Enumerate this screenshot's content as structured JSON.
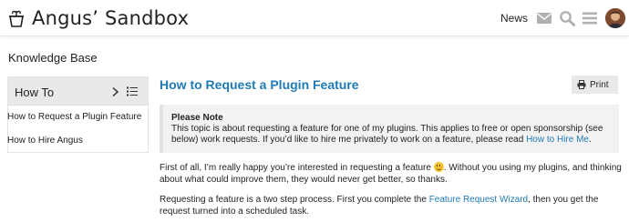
{
  "header": {
    "site_title": "Angus’ Sandbox",
    "news_label": "News",
    "icons": [
      "logo-icon",
      "mail-icon",
      "search-icon",
      "menu-icon",
      "avatar"
    ]
  },
  "page": {
    "section_title": "Knowledge Base"
  },
  "sidebar": {
    "heading": "How To",
    "items": [
      {
        "label": "How to Request a Plugin Feature"
      },
      {
        "label": "How to Hire Angus"
      }
    ]
  },
  "article": {
    "title": "How to Request a Plugin Feature",
    "print_label": "Print",
    "note": {
      "title": "Please Note",
      "text_before_link": "This topic is about requesting a feature for one of my plugins. This applies to free or open sponsorship (see below) work requests. If you’d like to hire me privately to work on a feature, please read ",
      "link": "How to Hire Me",
      "text_after_link": "."
    },
    "para1_before_emoji": "First of all, I’m really happy you’re interested in requesting a feature ",
    "para1_after_emoji": ". Without you using my plugins, and thinking about what could improve them, they would never get better, so thanks.",
    "para2_before_link": "Requesting a feature is a two step process. First you complete the ",
    "para2_link": "Feature Request Wizard",
    "para2_after_link": ", then you get the request turned into a scheduled task."
  },
  "colors": {
    "link": "#1f7ab5",
    "header_icon": "#b0b0b0",
    "sidebar_head_bg": "#e9e9e9",
    "note_bg": "#f2f2f2"
  }
}
